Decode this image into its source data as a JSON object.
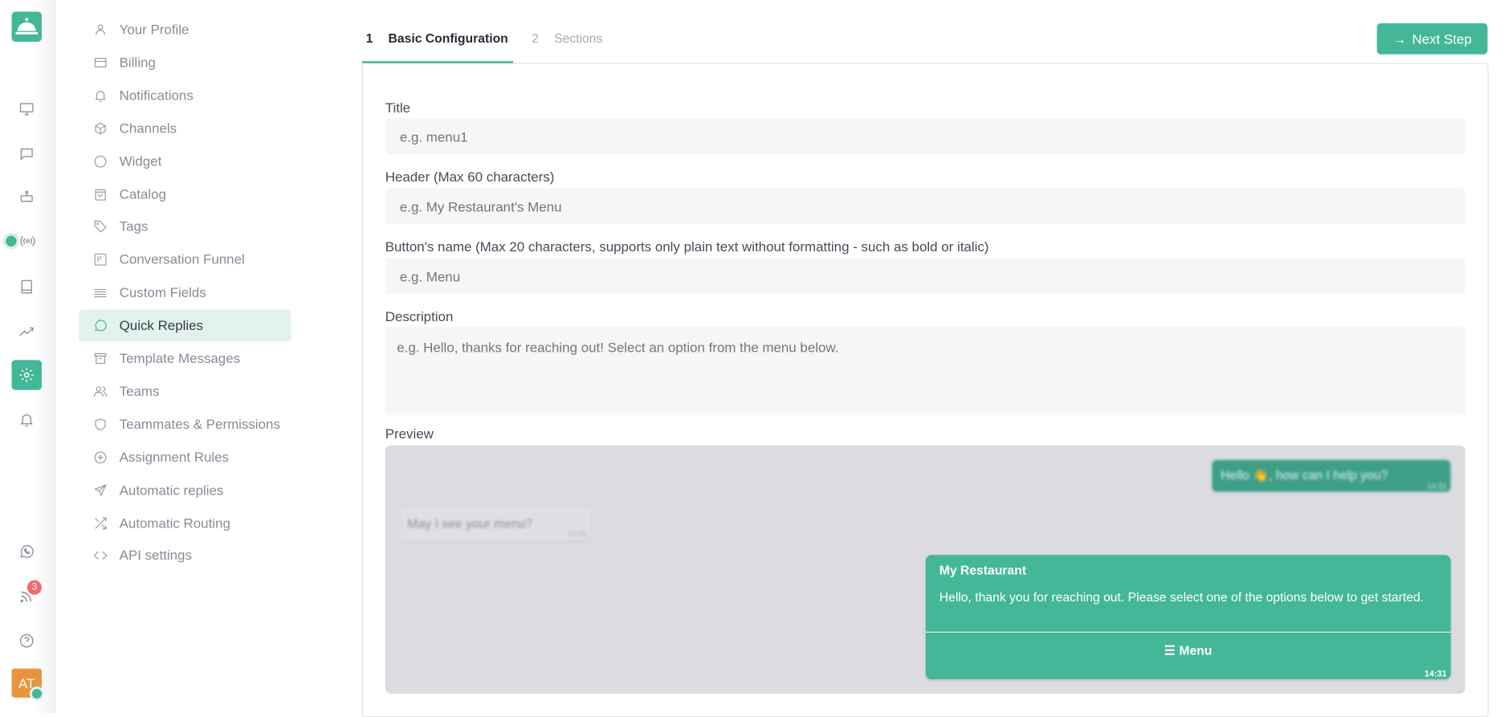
{
  "colors": {
    "accent": "#43b797",
    "avatar": "#e8943f",
    "badge": "#f26b6b"
  },
  "rail": {
    "icons": [
      "bell-service-logo-icon",
      "monitor-icon",
      "chat-icon",
      "robot-icon",
      "broadcast-icon",
      "book-icon",
      "trending-icon",
      "settings-icon",
      "notifications-icon",
      "whatsapp-icon",
      "rss-icon",
      "help-icon"
    ],
    "rss_badge": "3",
    "avatar_initials": "AT"
  },
  "settings_menu": {
    "items": [
      {
        "label": "Your Profile",
        "icon": "user-icon"
      },
      {
        "label": "Billing",
        "icon": "credit-card-icon"
      },
      {
        "label": "Notifications",
        "icon": "bell-icon"
      },
      {
        "label": "Channels",
        "icon": "cube-icon"
      },
      {
        "label": "Widget",
        "icon": "circle-icon"
      },
      {
        "label": "Catalog",
        "icon": "shopping-bag-icon"
      },
      {
        "label": "Tags",
        "icon": "tag-icon"
      },
      {
        "label": "Conversation Funnel",
        "icon": "kanban-icon"
      },
      {
        "label": "Custom Fields",
        "icon": "lines-icon"
      },
      {
        "label": "Quick Replies",
        "icon": "message-circle-icon",
        "active": true
      },
      {
        "label": "Template Messages",
        "icon": "archive-icon"
      },
      {
        "label": "Teams",
        "icon": "users-icon"
      },
      {
        "label": "Teammates & Permissions",
        "icon": "shield-icon"
      },
      {
        "label": "Assignment Rules",
        "icon": "plus-circle-icon"
      },
      {
        "label": "Automatic replies",
        "icon": "send-icon"
      },
      {
        "label": "Automatic Routing",
        "icon": "shuffle-icon"
      },
      {
        "label": "API settings",
        "icon": "code-icon"
      }
    ]
  },
  "steps": [
    {
      "num": "1",
      "label": "Basic Configuration",
      "active": true
    },
    {
      "num": "2",
      "label": "Sections",
      "active": false
    }
  ],
  "next_button": "Next Step",
  "form": {
    "title": {
      "label": "Title",
      "placeholder": "e.g. menu1",
      "value": ""
    },
    "header": {
      "label": "Header (Max 60 characters)",
      "placeholder": "e.g. My Restaurant's Menu",
      "value": ""
    },
    "button_name": {
      "label": "Button's name (Max 20 characters, supports only plain text without formatting - such as bold or italic)",
      "placeholder": "e.g. Menu",
      "value": ""
    },
    "description": {
      "label": "Description",
      "placeholder": "e.g. Hello, thanks for reaching out! Select an option from the menu below.",
      "value": ""
    }
  },
  "preview": {
    "label": "Preview",
    "outgoing_greeting": {
      "text": "Hello 👋, how can I help you?",
      "time": "14:31"
    },
    "incoming": {
      "text": "May I see your menu?",
      "time": "14:31"
    },
    "reply": {
      "header": "My Restaurant",
      "body": "Hello, thank you for reaching out. Please select one of the options below to get started.",
      "button": "Menu",
      "time": "14:31"
    }
  }
}
